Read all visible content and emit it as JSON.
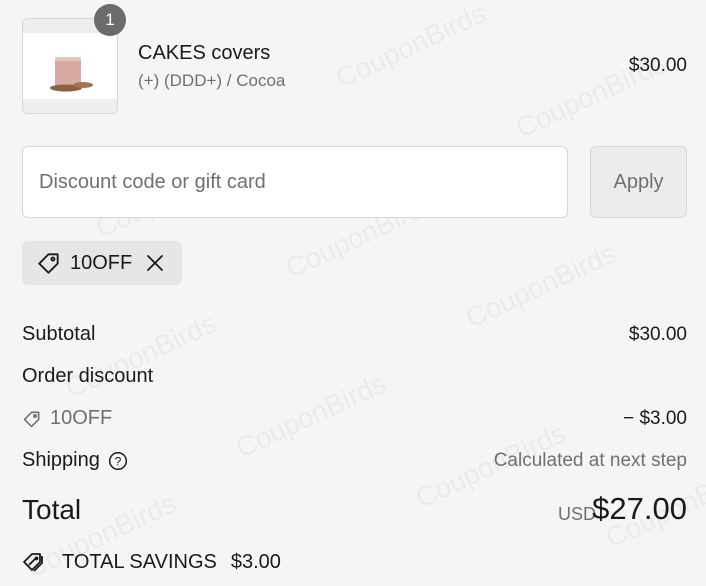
{
  "watermark": "CouponBirds",
  "line_item": {
    "quantity": "1",
    "title": "CAKES covers",
    "variant": "(+) (DDD+) / Cocoa",
    "price": "$30.00"
  },
  "discount": {
    "placeholder": "Discount code or gift card",
    "value": "",
    "apply_label": "Apply",
    "applied_code": "10OFF"
  },
  "summary": {
    "subtotal_label": "Subtotal",
    "subtotal_value": "$30.00",
    "order_discount_label": "Order discount",
    "discount_code": "10OFF",
    "discount_value": "− $3.00",
    "shipping_label": "Shipping",
    "shipping_value": "Calculated at next step",
    "total_label": "Total",
    "currency": "USD",
    "total_value": "$27.00",
    "savings_label": "TOTAL SAVINGS",
    "savings_value": "$3.00"
  },
  "icons": [
    "tag-icon",
    "close-icon",
    "help-icon",
    "savings-tag-icon"
  ],
  "colors": {
    "background": "#f5f5f5",
    "muted_text": "#707070",
    "badge": "#6b6b6b"
  }
}
